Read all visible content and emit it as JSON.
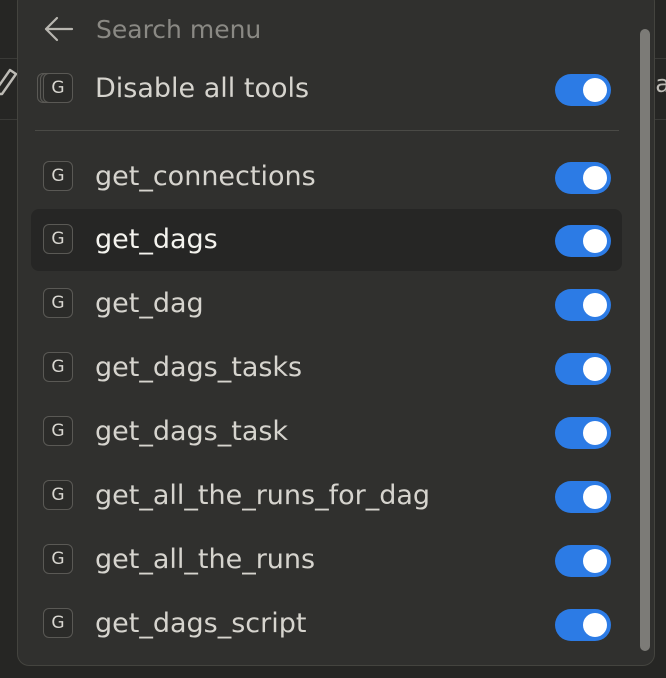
{
  "background": {
    "partial_label": "a"
  },
  "search": {
    "placeholder": "Search menu",
    "value": ""
  },
  "master_toggle": {
    "label": "Disable all tools",
    "badge": "G",
    "enabled": true
  },
  "tools": [
    {
      "badge": "G",
      "label": "get_connections",
      "enabled": true,
      "highlighted": false
    },
    {
      "badge": "G",
      "label": "get_dags",
      "enabled": true,
      "highlighted": true
    },
    {
      "badge": "G",
      "label": "get_dag",
      "enabled": true,
      "highlighted": false
    },
    {
      "badge": "G",
      "label": "get_dags_tasks",
      "enabled": true,
      "highlighted": false
    },
    {
      "badge": "G",
      "label": "get_dags_task",
      "enabled": true,
      "highlighted": false
    },
    {
      "badge": "G",
      "label": "get_all_the_runs_for_dag",
      "enabled": true,
      "highlighted": false
    },
    {
      "badge": "G",
      "label": "get_all_the_runs",
      "enabled": true,
      "highlighted": false
    },
    {
      "badge": "G",
      "label": "get_dags_script",
      "enabled": true,
      "highlighted": false
    }
  ],
  "colors": {
    "menu_bg": "#30302e",
    "toggle_on": "#2c7be5",
    "text": "#d6d4ce",
    "muted_text": "#8a8984"
  },
  "icons": {
    "back": "back-arrow-icon",
    "badge": "g-letter-icon",
    "background_tool": "pencil-icon"
  }
}
